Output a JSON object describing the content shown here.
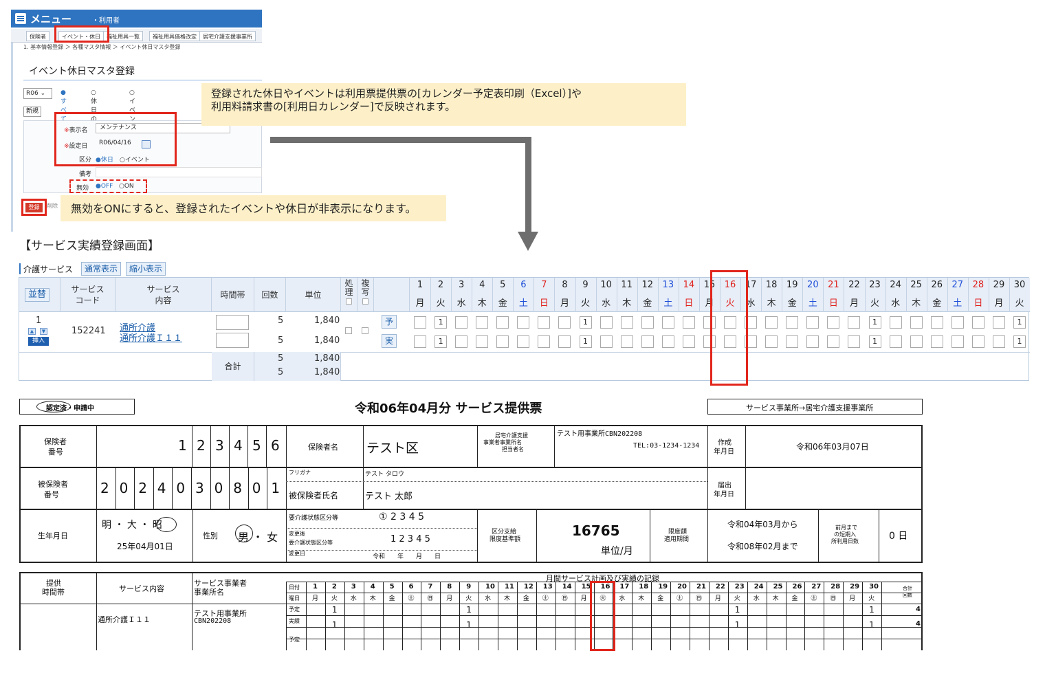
{
  "menu": {
    "title": "メニュー",
    "user": "・利用者",
    "tabs": [
      "保険者",
      "イベント・休日",
      "福祉用具一覧",
      "福祉用具価格改定",
      "居宅介護支援事業所"
    ]
  },
  "breadcrumb": "1. 基本情報登録 ＞ 各種マスタ情報 ＞ イベント休日マスタ登録",
  "page_title": "イベント休日マスタ登録",
  "filter": {
    "year": "R06",
    "radio_all": "●すべて",
    "radio_holiday": "○休日のみ",
    "radio_event": "○イベントのみ"
  },
  "new_button": "新規",
  "form": {
    "name_label": "表示名",
    "name_value": "メンテナンス",
    "date_label": "設定日",
    "date_value": "R06/04/16",
    "kubun_label": "区分",
    "kubun_holiday": "●休日",
    "kubun_event": "○イベント",
    "biko_label": "備考",
    "muko_label": "無効",
    "muko_off": "●OFF",
    "muko_on": "○ON",
    "req_mark": "※"
  },
  "register_button": "登録",
  "delete_button": "削除",
  "callout1": [
    "登録された休日やイベントは利用票提供票の[カレンダー予定表印刷（Excel）]や",
    "利用料請求書の[利用日カレンダー]で反映されます。"
  ],
  "callout2": "無効をONにすると、登録されたイベントや休日が非表示になります。",
  "section_title": "【サービス実績登録画面】",
  "svc": {
    "tab_label": "介護サービス",
    "btn_normal": "通常表示",
    "btn_compact": "縮小表示",
    "h_sort": "並替",
    "h_code1": "サービス",
    "h_code2": "コード",
    "h_content1": "サービス",
    "h_content2": "内容",
    "h_time": "時間帯",
    "h_count": "回数",
    "h_unit": "単位",
    "h_proc1": "処",
    "h_proc2": "理",
    "h_copy1": "複",
    "h_copy2": "写",
    "row_no": "1",
    "insert": "挿入",
    "code": "152241",
    "name1": "通所介護",
    "name2": "通所介護Ｉ１１",
    "plan_label": "予",
    "actual_label": "実",
    "count": "5",
    "unit": "1,840",
    "total_label": "合計",
    "total_count": "5",
    "total_unit": "1,840",
    "days": [
      "1",
      "2",
      "3",
      "4",
      "5",
      "6",
      "7",
      "8",
      "9",
      "10",
      "11",
      "12",
      "13",
      "14",
      "15",
      "16",
      "17",
      "18",
      "19",
      "20",
      "21",
      "22",
      "23",
      "24",
      "25",
      "26",
      "27",
      "28",
      "29",
      "30"
    ],
    "weekdays": [
      "月",
      "火",
      "水",
      "木",
      "金",
      "土",
      "日",
      "月",
      "火",
      "水",
      "木",
      "金",
      "土",
      "日",
      "月",
      "火",
      "水",
      "木",
      "金",
      "土",
      "日",
      "月",
      "火",
      "水",
      "木",
      "金",
      "土",
      "日",
      "月",
      "火"
    ],
    "marked_days": [
      2,
      9,
      23,
      30
    ],
    "mark_value": "1"
  },
  "paper": {
    "cert": "認定済・申請中",
    "title": "令和06年04月分 サービス提供票",
    "direction": "サービス事業所→居宅介護支援事業所",
    "insurer_label": [
      "保険者",
      "番号"
    ],
    "insurer_digits": [
      "1",
      "2",
      "3",
      "4",
      "5",
      "6"
    ],
    "insurer_name_label": "保険者名",
    "insurer_name": "テスト区",
    "care_office_label": [
      "居宅介護支援",
      "事業者事業所名",
      "担当者名"
    ],
    "care_office": "テスト用事業所CBN202208",
    "tel": "TEL:03-1234-1234",
    "created_label": [
      "作成",
      "年月日"
    ],
    "created": "令和06年03月07日",
    "insured_label": [
      "被保険者",
      "番号"
    ],
    "insured_digits": [
      "2",
      "0",
      "2",
      "4",
      "0",
      "3",
      "0",
      "8",
      "0",
      "1"
    ],
    "furigana_label": "フリガナ",
    "furigana": "テスト タロウ",
    "insured_name_label": "被保険者氏名",
    "insured_name": "テスト 太郎",
    "filed_label": [
      "届出",
      "年月日"
    ],
    "birth_label": "生年月日",
    "era": "明 ・ 大 ・ 昭",
    "birth": "25年04月01日",
    "sex_label": "性別",
    "sex": "男 ・ 女",
    "care_level_label": "要介護状態区分等",
    "care_levels": "① 2 3 4 5",
    "changed_label": [
      "変更後",
      "要介護状態区分等",
      "変更日"
    ],
    "changed_levels": "1 2 3 4 5",
    "changed_date": "令和　　年　　月　　日",
    "limit_label": [
      "区分支給",
      "限度基準額"
    ],
    "limit_value": "16765",
    "limit_unit": "単位/月",
    "period_label": [
      "限度額",
      "適用期間"
    ],
    "period_from": "令和04年03月から",
    "period_to": "令和08年02月まで",
    "short_label": [
      "前月まで",
      "の短期入",
      "所利用日数"
    ],
    "short_value": "0 日",
    "bt_time_label": [
      "提供",
      "時間帯"
    ],
    "bt_content_label": "サービス内容",
    "bt_office_label": [
      "サービス事業者",
      "事業所名"
    ],
    "bt_month_label": "月間サービス計画及び実績の記録",
    "bt_date": "日付",
    "bt_dow": "曜日",
    "bt_total": [
      "合計",
      "回数"
    ],
    "bt_days": [
      "1",
      "2",
      "3",
      "4",
      "5",
      "6",
      "7",
      "8",
      "9",
      "10",
      "11",
      "12",
      "13",
      "14",
      "15",
      "16",
      "17",
      "18",
      "19",
      "20",
      "21",
      "22",
      "23",
      "24",
      "25",
      "26",
      "27",
      "28",
      "29",
      "30"
    ],
    "bt_weekdays": [
      "月",
      "火",
      "水",
      "木",
      "金",
      "㊏",
      "㊐",
      "月",
      "火",
      "水",
      "木",
      "金",
      "㊏",
      "㊐",
      "月",
      "㊋",
      "水",
      "木",
      "金",
      "㊏",
      "㊐",
      "月",
      "火",
      "水",
      "木",
      "金",
      "㊏",
      "㊐",
      "月",
      "火"
    ],
    "bt_service": "通所介護Ｉ１１",
    "bt_office": [
      "テスト用事業所",
      "CBN202208"
    ],
    "bt_plan": "予定",
    "bt_actual": "実績",
    "bt_marks": [
      2,
      9,
      23,
      30
    ],
    "bt_mark_value": "1",
    "bt_total_value": "4"
  }
}
